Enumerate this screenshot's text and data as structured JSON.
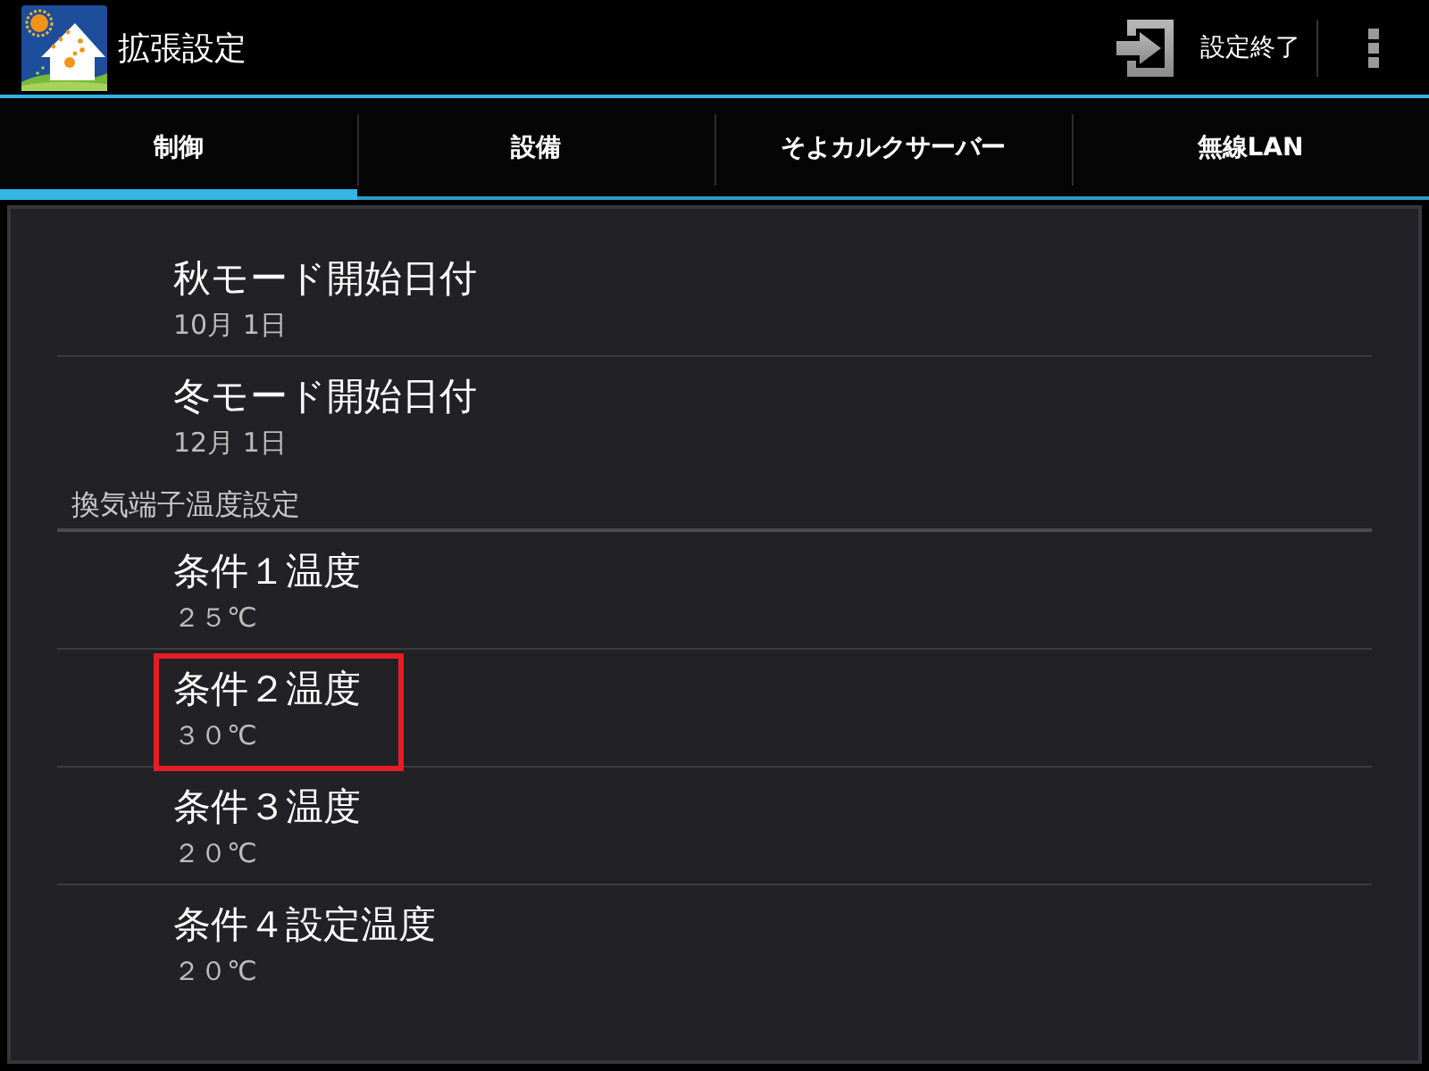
{
  "action_bar": {
    "title": "拡張設定",
    "action_label": "設定終了"
  },
  "tabs": [
    {
      "label": "制御",
      "selected": true
    },
    {
      "label": "設備",
      "selected": false
    },
    {
      "label": "そよカルクサーバー",
      "selected": false
    },
    {
      "label": "無線LAN",
      "selected": false
    }
  ],
  "preferences": [
    {
      "kind": "preference",
      "title": "秋モード開始日付",
      "summary": "10月 1日",
      "highlighted": false
    },
    {
      "kind": "preference",
      "title": "冬モード開始日付",
      "summary": "12月 1日",
      "highlighted": false
    },
    {
      "kind": "category",
      "title": "換気端子温度設定"
    },
    {
      "kind": "preference",
      "title": "条件１温度",
      "summary": "２５℃",
      "highlighted": false
    },
    {
      "kind": "preference",
      "title": "条件２温度",
      "summary": "３０℃",
      "highlighted": true
    },
    {
      "kind": "preference",
      "title": "条件３温度",
      "summary": "２０℃",
      "highlighted": false
    },
    {
      "kind": "preference",
      "title": "条件４設定温度",
      "summary": "２０℃",
      "highlighted": false
    }
  ]
}
